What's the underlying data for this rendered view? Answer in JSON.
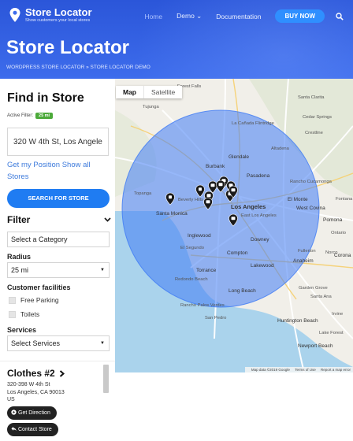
{
  "header": {
    "brand": "Store Locator",
    "tagline": "Show customers your local stores",
    "nav": [
      "Home",
      "Demo ⌄",
      "Documentation"
    ],
    "buy_label": "BUY NOW",
    "page_title": "Store Locator",
    "breadcrumb": "WORDPRESS STORE LOCATOR » STORE LOCATOR DEMO",
    "accent": "#1f7cf2"
  },
  "sidebar": {
    "title": "Find in Store",
    "active_filter_label": "Active Filter:",
    "active_filter_value": "25 mi",
    "address_value": "320 W 4th St, Los Angeles,",
    "geo_link": "Get my Position",
    "show_all_link": "Show all Stores",
    "search_label": "SEARCH FOR STORE",
    "filter_title": "Filter",
    "category_value": "Select a Category",
    "radius_label": "Radius",
    "radius_value": "25 mi",
    "facilities_label": "Customer facilities",
    "facilities": [
      {
        "label": "Free Parking",
        "checked": false
      },
      {
        "label": "Toilets",
        "checked": false
      }
    ],
    "services_label": "Services",
    "services_value": "Select Services"
  },
  "result": {
    "title": "Clothes #2",
    "address_lines": [
      "320-398 W 4th St",
      "Los Angeles, CA 90013",
      "US"
    ],
    "direction_label": "Get Direction",
    "contact_label": "Contact Store"
  },
  "map": {
    "tabs": [
      "Map",
      "Satellite"
    ],
    "attribution": [
      "Map data ©2019 Google",
      "Terms of Use",
      "Report a map error"
    ],
    "labels": {
      "forest_falls": "Forest Falls",
      "la_canada": "La Cañada Flintridge",
      "tujunga": "Tujunga",
      "santa_clarita": "Santa Clarita",
      "altadena": "Altadena",
      "cedar_springs": "Cedar Springs",
      "crestline": "Crestline",
      "glendale": "Glendale",
      "burbank": "Burbank",
      "pasadena": "Pasadena",
      "los_angeles": "Los Angeles",
      "beverly_hills": "Beverly Hills",
      "topanga": "Topanga",
      "santa_monica": "Santa Monica",
      "east_la": "East Los Angeles",
      "inglewood": "Inglewood",
      "downey": "Downey",
      "west_covina": "West Covina",
      "pomona": "Pomona",
      "ontario": "Ontario",
      "rancho": "Rancho Cucamonga",
      "fontana": "Fontana",
      "el_segundo": "El Segundo",
      "el_monte": "El Monte",
      "redondo_beach": "Redondo Beach",
      "torrance": "Torrance",
      "compton": "Compton",
      "lakewood": "Lakewood",
      "fullerton": "Fullerton",
      "corona": "Corona",
      "norco": "Norco",
      "anaheim": "Anaheim",
      "irvine": "Irvine",
      "long_beach": "Long Beach",
      "santa_ana": "Santa Ana",
      "garden_grove": "Garden Grove",
      "san_pedro": "San Pedro",
      "rancho_palos_verdes": "Rancho Palos Verdes",
      "huntington_beach": "Huntington Beach",
      "newport_beach": "Newport Beach",
      "lake_forest": "Lake Forest"
    },
    "radius_circle_color": "#3f7bf5",
    "ocean_color": "#aad3ec",
    "marker_color": "#1a1a1a",
    "store_markers": [
      "clothes",
      "clothes",
      "shop",
      "shop",
      "shop",
      "shop",
      "shop",
      "shop",
      "shop",
      "shop",
      "shop"
    ]
  }
}
